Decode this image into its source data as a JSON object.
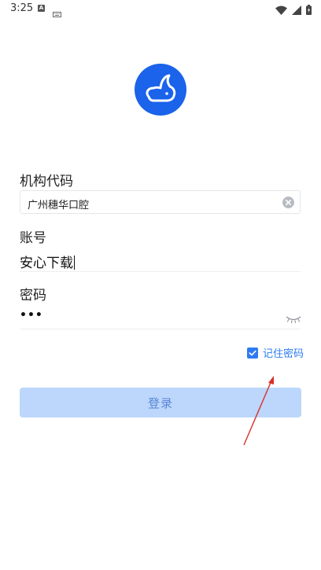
{
  "status_bar": {
    "time": "3:25",
    "notif_letter": "A"
  },
  "form": {
    "org_label": "机构代码",
    "org_value": "广州穗华口腔",
    "account_label": "账号",
    "account_value": "安心下载",
    "password_label": "密码",
    "password_value": "•••"
  },
  "remember": {
    "label": "记住密码",
    "checked": true
  },
  "login_button": {
    "label": "登录"
  },
  "colors": {
    "brand_blue": "#1a63ea",
    "accent_blue": "#2e7bf2",
    "login_button_bg": "#bcd7fb",
    "annotation_red": "#d9302b"
  }
}
